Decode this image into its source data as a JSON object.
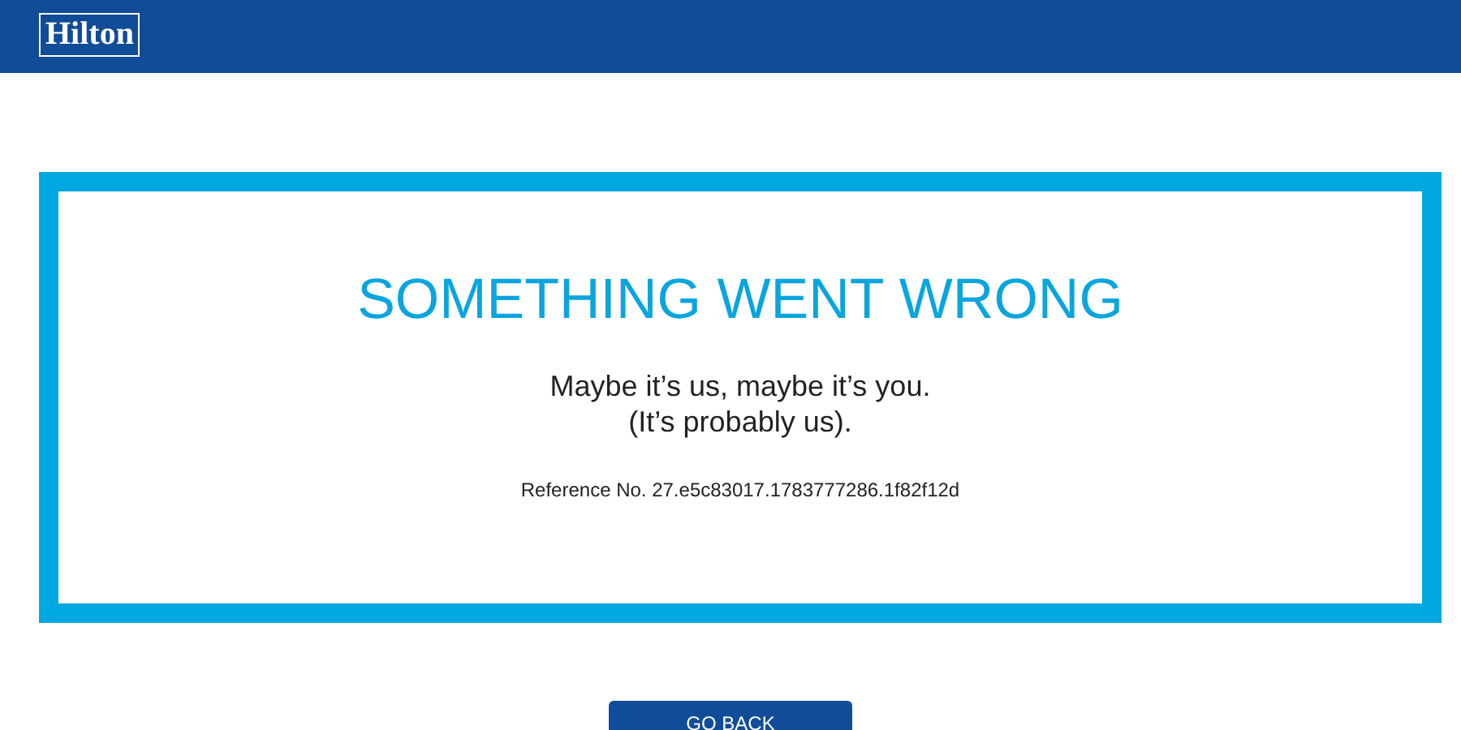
{
  "header": {
    "logo": "Hilton"
  },
  "error": {
    "title": "SOMETHING WENT WRONG",
    "message_lines": [
      "Maybe it’s us, maybe it’s you.",
      "(It’s probably us)."
    ],
    "reference": "Reference No. 27.e5c83017.1783777286.1f82f12d"
  },
  "button": {
    "label": "GO BACK"
  }
}
